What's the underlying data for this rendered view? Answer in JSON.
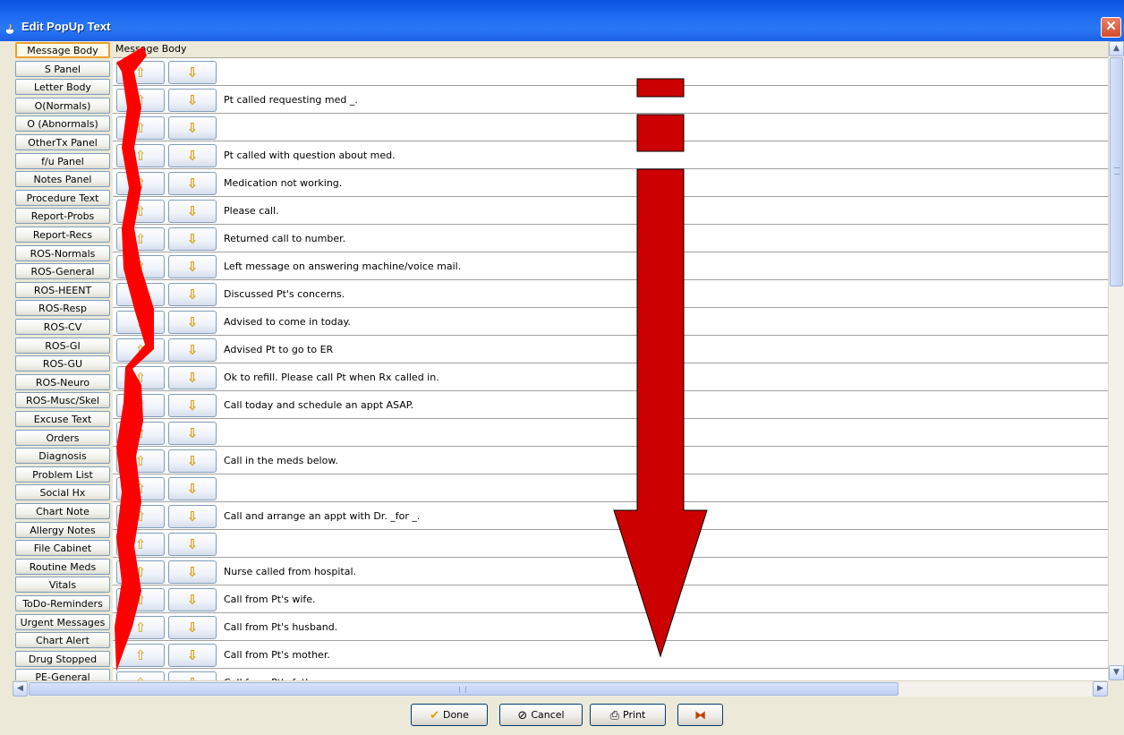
{
  "window": {
    "title": "Edit PopUp Text",
    "close_label": "✕"
  },
  "header": {
    "column_label": "Message Body"
  },
  "categories": [
    {
      "label": "Message Body",
      "selected": true
    },
    {
      "label": "S Panel"
    },
    {
      "label": "Letter Body"
    },
    {
      "label": "O(Normals)"
    },
    {
      "label": "O (Abnormals)"
    },
    {
      "label": "OtherTx Panel"
    },
    {
      "label": "f/u Panel"
    },
    {
      "label": "Notes Panel"
    },
    {
      "label": "Procedure Text"
    },
    {
      "label": "Report-Probs"
    },
    {
      "label": "Report-Recs"
    },
    {
      "label": "ROS-Normals"
    },
    {
      "label": "ROS-General"
    },
    {
      "label": "ROS-HEENT"
    },
    {
      "label": "ROS-Resp"
    },
    {
      "label": "ROS-CV"
    },
    {
      "label": "ROS-GI"
    },
    {
      "label": "ROS-GU"
    },
    {
      "label": "ROS-Neuro"
    },
    {
      "label": "ROS-Musc/Skel"
    },
    {
      "label": "Excuse Text"
    },
    {
      "label": "Orders"
    },
    {
      "label": "Diagnosis"
    },
    {
      "label": "Problem List"
    },
    {
      "label": "Social Hx"
    },
    {
      "label": "Chart Note"
    },
    {
      "label": "Allergy Notes"
    },
    {
      "label": "File Cabinet"
    },
    {
      "label": "Routine Meds"
    },
    {
      "label": "Vitals"
    },
    {
      "label": "ToDo-Reminders"
    },
    {
      "label": "Urgent Messages"
    },
    {
      "label": "Chart Alert"
    },
    {
      "label": "Drug Stopped"
    },
    {
      "label": "PE-General"
    }
  ],
  "rows": [
    {
      "text": ""
    },
    {
      "text": "Pt called requesting med _."
    },
    {
      "text": ""
    },
    {
      "text": "Pt called with question about med."
    },
    {
      "text": "Medication not working."
    },
    {
      "text": "Please call."
    },
    {
      "text": "Returned call to number."
    },
    {
      "text": "Left message on answering machine/voice mail."
    },
    {
      "text": "Discussed Pt's concerns."
    },
    {
      "text": "Advised to come in today."
    },
    {
      "text": "Advised Pt to go to ER"
    },
    {
      "text": "Ok to refill.  Please call Pt when Rx called in."
    },
    {
      "text": "Call today and schedule an appt ASAP."
    },
    {
      "text": ""
    },
    {
      "text": "Call in the meds below."
    },
    {
      "text": ""
    },
    {
      "text": "Call and arrange an appt with Dr. _for _."
    },
    {
      "text": ""
    },
    {
      "text": "Nurse called from hospital."
    },
    {
      "text": "Call from Pt's wife."
    },
    {
      "text": "Call from Pt's husband."
    },
    {
      "text": "Call from Pt's mother."
    },
    {
      "text": "Call from Pt's father"
    }
  ],
  "row_buttons": {
    "up_icon": "arrow-up-icon",
    "down_icon": "arrow-down-icon"
  },
  "footer": {
    "done_label": "Done",
    "cancel_label": "Cancel",
    "print_label": "Print"
  },
  "annotations": {
    "arrow_color": "#cc0000",
    "ribbon_color": "#ff0000"
  }
}
